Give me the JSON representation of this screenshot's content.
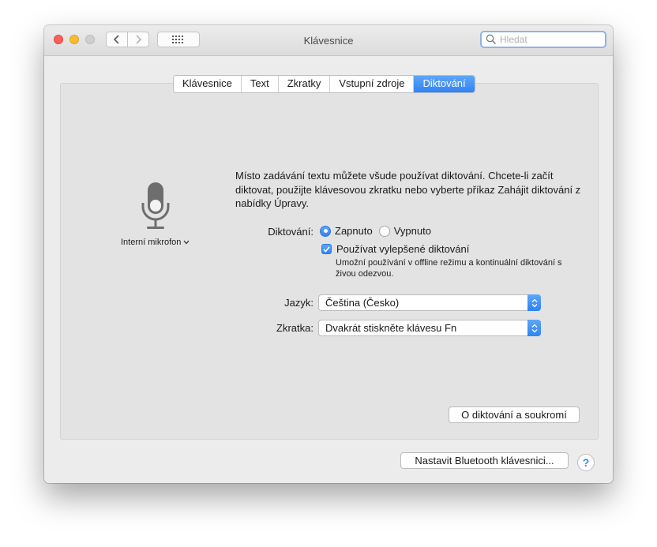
{
  "window": {
    "title": "Klávesnice",
    "search_placeholder": "Hledat"
  },
  "tabs": [
    {
      "label": "Klávesnice",
      "active": false
    },
    {
      "label": "Text",
      "active": false
    },
    {
      "label": "Zkratky",
      "active": false
    },
    {
      "label": "Vstupní zdroje",
      "active": false
    },
    {
      "label": "Diktování",
      "active": true
    }
  ],
  "microphone": {
    "icon": "microphone-icon",
    "source_label": "Interní mikrofon"
  },
  "dictation": {
    "description": "Místo zadávání textu můžete všude používat diktování. Chcete-li začít diktovat, použijte klávesovou zkratku nebo vyberte příkaz Zahájit diktování z nabídky Úpravy.",
    "toggle_label": "Diktování:",
    "on_label": "Zapnuto",
    "off_label": "Vypnuto",
    "selected": "Zapnuto",
    "enhanced_label": "Používat vylepšené diktování",
    "enhanced_checked": true,
    "enhanced_note": "Umožní používání v offline režimu a kontinuální diktování s živou odezvou.",
    "language_label": "Jazyk:",
    "language_value": "Čeština (Česko)",
    "shortcut_label": "Zkratka:",
    "shortcut_value": "Dvakrát stiskněte klávesu Fn",
    "privacy_button": "O diktování a soukromí"
  },
  "footer": {
    "bluetooth_button": "Nastavit Bluetooth klávesnici...",
    "help_label": "?"
  },
  "colors": {
    "accent": "#2f83f4",
    "close": "#fc5f57",
    "minimize": "#fdbc2e"
  }
}
